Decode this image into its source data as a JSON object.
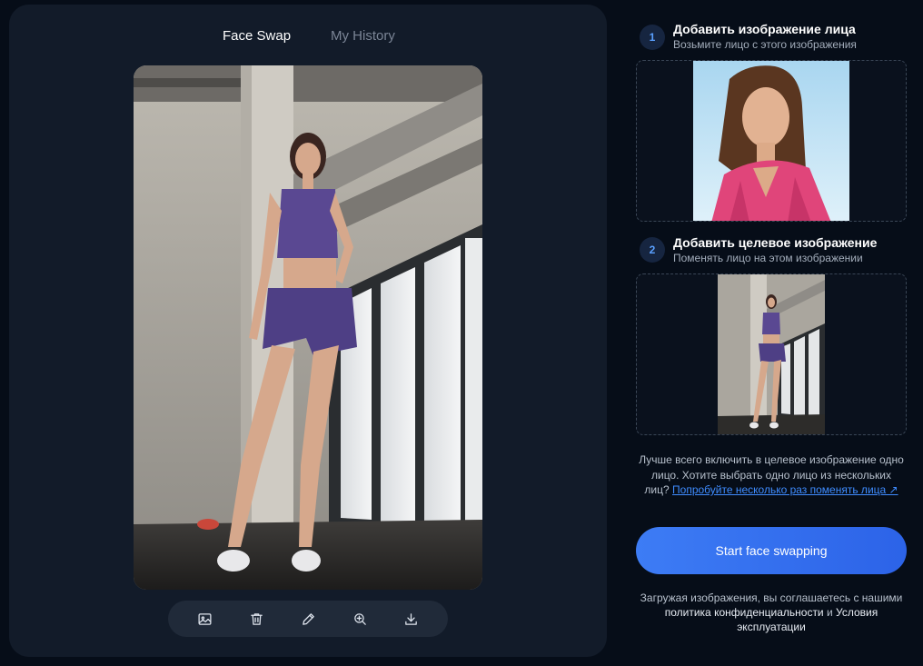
{
  "tabs": [
    {
      "label": "Face Swap",
      "active": true
    },
    {
      "label": "My History",
      "active": false
    }
  ],
  "toolbar": {
    "icons": [
      "image-icon",
      "trash-icon",
      "pencil-icon",
      "zoom-in-icon",
      "download-icon"
    ]
  },
  "steps": [
    {
      "number": "1",
      "title": "Добавить изображение лица",
      "subtitle": "Возьмите лицо с этого изображения"
    },
    {
      "number": "2",
      "title": "Добавить целевое изображение",
      "subtitle": "Поменять лицо на этом изображении"
    }
  ],
  "hint": {
    "text": "Лучше всего включить в целевое изображение одно лицо. Хотите выбрать одно лицо из нескольких лиц?",
    "link": "Попробуйте несколько раз поменять лица ↗"
  },
  "start_button": {
    "label": "Start face swapping"
  },
  "terms": {
    "prefix": "Загружая изображения, вы соглашаетесь с нашими",
    "privacy": "политика конфиденциальности",
    "and": "и",
    "terms_link": "Условия эксплуатации"
  },
  "colors": {
    "background": "#060d18",
    "panel": "#121b29",
    "accent": "#3d7cf5",
    "link": "#3f8cff"
  }
}
